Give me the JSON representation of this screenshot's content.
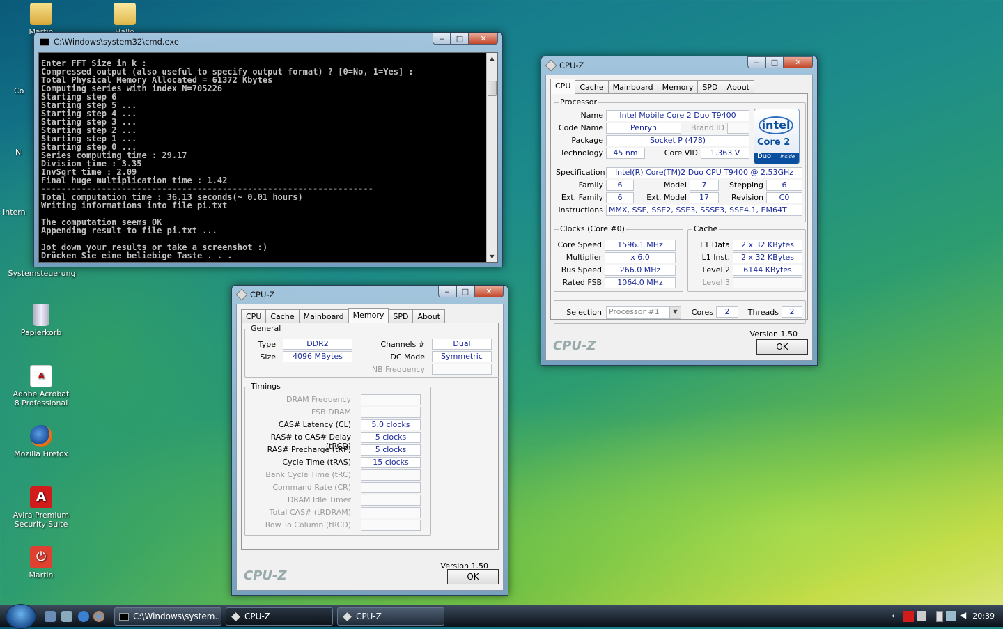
{
  "desktop": {
    "icons": [
      {
        "label": "Martin"
      },
      {
        "label": "Hallo"
      },
      {
        "label": "Systemsteuerung"
      },
      {
        "label": "Papierkorb"
      },
      {
        "label": "Adobe Acrobat 8 Professional"
      },
      {
        "label": "Mozilla Firefox"
      },
      {
        "label": "Avira Premium Security Suite"
      },
      {
        "label": "Martin"
      }
    ],
    "partial_labels": [
      "Co",
      "N",
      "Intern"
    ]
  },
  "cmd": {
    "title": "C:\\Windows\\system32\\cmd.exe",
    "output": "Enter FFT Size in k :\nCompressed output (also useful to specify output format) ? [0=No, 1=Yes] :\nTotal Physical Memory Allocated = 61372 Kbytes\nComputing series with index N=705226\nStarting step 6\nStarting step 5 ...\nStarting step 4 ...\nStarting step 3 ...\nStarting step 2 ...\nStarting step 1 ...\nStarting step 0 ...\nSeries computing time : 29.17\nDivision time : 3.35\nInvSqrt time : 2.09\nFinal huge multiplication time : 1.42\n------------------------------------------------------------------\nTotal computation time : 36.13 seconds(~ 0.01 hours)\nWriting informations into file pi.txt\n\nThe computation seems OK\nAppending result to file pi.txt ...\n\nJot down your results or take a screenshot :)\nDrücken Sie eine beliebige Taste . . ."
  },
  "cpuz_main": {
    "title": "CPU-Z",
    "tabs": [
      "CPU",
      "Cache",
      "Mainboard",
      "Memory",
      "SPD",
      "About"
    ],
    "active_tab": "CPU",
    "processor": {
      "group_label": "Processor",
      "name_label": "Name",
      "name": "Intel Mobile Core 2 Duo T9400",
      "codename_label": "Code Name",
      "codename": "Penryn",
      "brandid_label": "Brand ID",
      "package_label": "Package",
      "package": "Socket P (478)",
      "technology_label": "Technology",
      "technology": "45 nm",
      "corevid_label": "Core VID",
      "corevid": "1.363 V",
      "spec_label": "Specification",
      "spec": "Intel(R) Core(TM)2 Duo CPU      T9400  @ 2.53GHz",
      "family_label": "Family",
      "family": "6",
      "model_label": "Model",
      "model": "7",
      "stepping_label": "Stepping",
      "stepping": "6",
      "extfamily_label": "Ext. Family",
      "extfamily": "6",
      "extmodel_label": "Ext. Model",
      "extmodel": "17",
      "revision_label": "Revision",
      "revision": "C0",
      "instructions_label": "Instructions",
      "instructions": "MMX, SSE, SSE2, SSE3, SSSE3, SSE4.1, EM64T"
    },
    "logo": {
      "line1": "intel",
      "line2": "Core 2",
      "line3": "Duo",
      "line4": "inside"
    },
    "clocks": {
      "group_label": "Clocks (Core #0)",
      "corespeed_label": "Core Speed",
      "corespeed": "1596.1 MHz",
      "multiplier_label": "Multiplier",
      "multiplier": "x 6.0",
      "busspeed_label": "Bus Speed",
      "busspeed": "266.0 MHz",
      "ratedfsb_label": "Rated FSB",
      "ratedfsb": "1064.0 MHz"
    },
    "cache": {
      "group_label": "Cache",
      "l1data_label": "L1 Data",
      "l1data": "2 x 32 KBytes",
      "l1inst_label": "L1 Inst.",
      "l1inst": "2 x 32 KBytes",
      "level2_label": "Level 2",
      "level2": "6144 KBytes",
      "level3_label": "Level 3"
    },
    "selection_label": "Selection",
    "selection": "Processor #1",
    "cores_label": "Cores",
    "cores": "2",
    "threads_label": "Threads",
    "threads": "2",
    "version": "Version 1.50",
    "brand": "CPU-Z",
    "ok": "OK"
  },
  "cpuz_mem": {
    "title": "CPU-Z",
    "tabs": [
      "CPU",
      "Cache",
      "Mainboard",
      "Memory",
      "SPD",
      "About"
    ],
    "active_tab": "Memory",
    "general": {
      "group_label": "General",
      "type_label": "Type",
      "type": "DDR2",
      "size_label": "Size",
      "size": "4096 MBytes",
      "channels_label": "Channels #",
      "channels": "Dual",
      "dcmode_label": "DC Mode",
      "dcmode": "Symmetric",
      "nbfreq_label": "NB Frequency"
    },
    "timings": {
      "group_label": "Timings",
      "rows": [
        {
          "label": "DRAM Frequency",
          "value": "",
          "enabled": false
        },
        {
          "label": "FSB:DRAM",
          "value": "",
          "enabled": false
        },
        {
          "label": "CAS# Latency (CL)",
          "value": "5.0 clocks",
          "enabled": true
        },
        {
          "label": "RAS# to CAS# Delay (tRCD)",
          "value": "5 clocks",
          "enabled": true
        },
        {
          "label": "RAS# Precharge (tRP)",
          "value": "5 clocks",
          "enabled": true
        },
        {
          "label": "Cycle Time (tRAS)",
          "value": "15 clocks",
          "enabled": true
        },
        {
          "label": "Bank Cycle Time (tRC)",
          "value": "",
          "enabled": false
        },
        {
          "label": "Command Rate (CR)",
          "value": "",
          "enabled": false
        },
        {
          "label": "DRAM Idle Timer",
          "value": "",
          "enabled": false
        },
        {
          "label": "Total CAS# (tRDRAM)",
          "value": "",
          "enabled": false
        },
        {
          "label": "Row To Column (tRCD)",
          "value": "",
          "enabled": false
        }
      ]
    },
    "version": "Version 1.50",
    "brand": "CPU-Z",
    "ok": "OK"
  },
  "taskbar": {
    "tasks": [
      {
        "label": "C:\\Windows\\system..."
      },
      {
        "label": "CPU-Z"
      },
      {
        "label": "CPU-Z"
      }
    ],
    "clock": "20:39"
  }
}
